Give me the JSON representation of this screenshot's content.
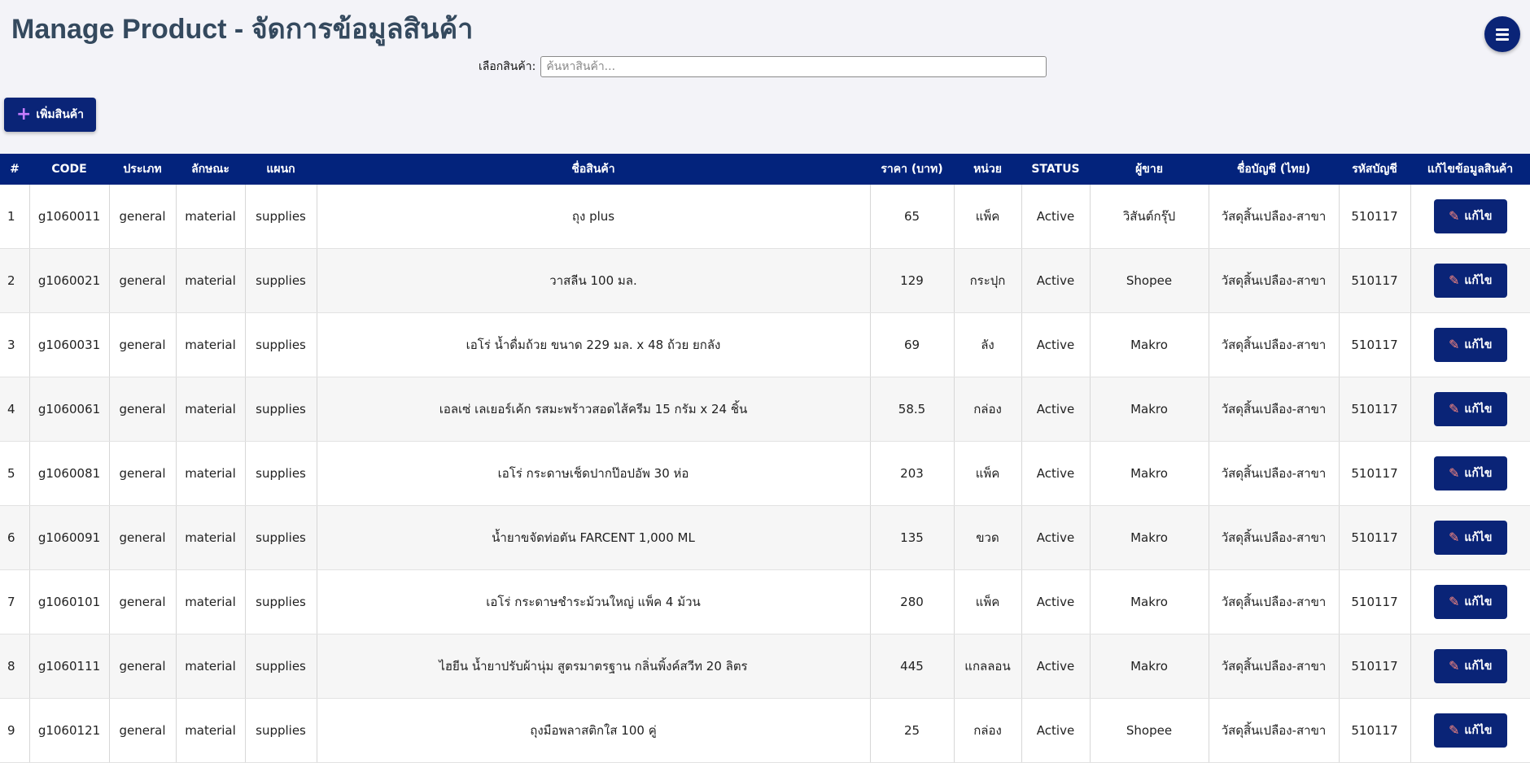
{
  "header": {
    "title": "Manage Product - จัดการข้อมูลสินค้า",
    "menu_icon": "menu-icon"
  },
  "search": {
    "label": "เลือกสินค้า:",
    "placeholder": "ค้นหาสินค้า...",
    "value": ""
  },
  "toolbar": {
    "add_label": "เพิ่มสินค้า",
    "add_icon": "plus-icon"
  },
  "colors": {
    "primary": "#0a2477",
    "header_bg": "#03237c",
    "title": "#34495e",
    "add_icon": "#c77dff",
    "edit_icon": "#ff8a80"
  },
  "table": {
    "columns": [
      "#",
      "CODE",
      "ประเภท",
      "ลักษณะ",
      "แผนก",
      "ชื่อสินค้า",
      "ราคา (บาท)",
      "หน่วย",
      "STATUS",
      "ผู้ขาย",
      "ชื่อบัญชี (ไทย)",
      "รหัสบัญชี",
      "แก้ไขข้อมูลสินค้า"
    ],
    "edit_label": "แก้ไข",
    "edit_icon": "pencil-icon",
    "rows": [
      [
        "1",
        "g1060011",
        "general",
        "material",
        "supplies",
        "ถุง plus",
        "65",
        "แพ็ค",
        "Active",
        "วิสันต์กรุ๊ป",
        "วัสดุสิ้นเปลือง-สาขา",
        "510117"
      ],
      [
        "2",
        "g1060021",
        "general",
        "material",
        "supplies",
        "วาสลีน 100 มล.",
        "129",
        "กระปุก",
        "Active",
        "Shopee",
        "วัสดุสิ้นเปลือง-สาขา",
        "510117"
      ],
      [
        "3",
        "g1060031",
        "general",
        "material",
        "supplies",
        "เอโร่ น้ำดื่มถ้วย ขนาด 229 มล. x 48 ถ้วย ยกลัง",
        "69",
        "ลัง",
        "Active",
        "Makro",
        "วัสดุสิ้นเปลือง-สาขา",
        "510117"
      ],
      [
        "4",
        "g1060061",
        "general",
        "material",
        "supplies",
        "เอลเซ่ เลเยอร์เค้ก รสมะพร้าวสอดไส้ครีม 15 กรัม x 24 ชิ้น",
        "58.5",
        "กล่อง",
        "Active",
        "Makro",
        "วัสดุสิ้นเปลือง-สาขา",
        "510117"
      ],
      [
        "5",
        "g1060081",
        "general",
        "material",
        "supplies",
        "เอโร่ กระดาษเช็ดปากป๊อปอัพ 30 ห่อ",
        "203",
        "แพ็ค",
        "Active",
        "Makro",
        "วัสดุสิ้นเปลือง-สาขา",
        "510117"
      ],
      [
        "6",
        "g1060091",
        "general",
        "material",
        "supplies",
        "น้ำยาขจัดท่อตัน FARCENT 1,000 ML",
        "135",
        "ขวด",
        "Active",
        "Makro",
        "วัสดุสิ้นเปลือง-สาขา",
        "510117"
      ],
      [
        "7",
        "g1060101",
        "general",
        "material",
        "supplies",
        "เอโร่ กระดาษชำระม้วนใหญ่ แพ็ค 4 ม้วน",
        "280",
        "แพ็ค",
        "Active",
        "Makro",
        "วัสดุสิ้นเปลือง-สาขา",
        "510117"
      ],
      [
        "8",
        "g1060111",
        "general",
        "material",
        "supplies",
        "ไฮยีน น้ำยาปรับผ้านุ่ม สูตรมาตรฐาน กลิ่นพิ้งค์สวีท 20 ลิตร",
        "445",
        "แกลลอน",
        "Active",
        "Makro",
        "วัสดุสิ้นเปลือง-สาขา",
        "510117"
      ],
      [
        "9",
        "g1060121",
        "general",
        "material",
        "supplies",
        "ถุงมือพลาสติกใส 100 คู่",
        "25",
        "กล่อง",
        "Active",
        "Shopee",
        "วัสดุสิ้นเปลือง-สาขา",
        "510117"
      ]
    ]
  }
}
